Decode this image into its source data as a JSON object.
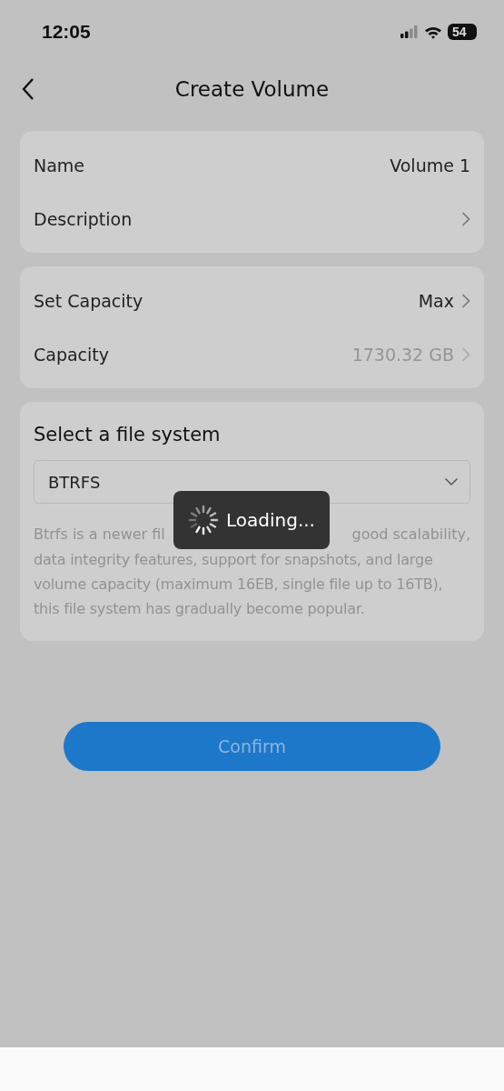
{
  "status_bar": {
    "time": "12:05",
    "battery": "54"
  },
  "nav": {
    "title": "Create Volume"
  },
  "groups": [
    {
      "rows": [
        {
          "kind": "value",
          "label": "Name",
          "value": "Volume 1",
          "muted": false
        },
        {
          "kind": "link",
          "label": "Description"
        }
      ]
    },
    {
      "rows": [
        {
          "kind": "value-link",
          "label": "Set Capacity",
          "value": "Max",
          "muted": false
        },
        {
          "kind": "value-link",
          "label": "Capacity",
          "value": "1730.32 GB",
          "muted": true
        }
      ]
    }
  ],
  "file_system": {
    "heading": "Select a file system",
    "selected_value": "BTRFS",
    "description_first_line": [
      "Btrfs is a newer fil",
      "good scalability,"
    ],
    "description_rest": "data integrity features, support for snapshots, and large volume capacity (maximum 16EB, single file up to 16TB), this file system has gradually become popular."
  },
  "confirm_button": {
    "label": "Confirm",
    "disabled": true
  },
  "loading_toast": {
    "label": "Loading..."
  }
}
